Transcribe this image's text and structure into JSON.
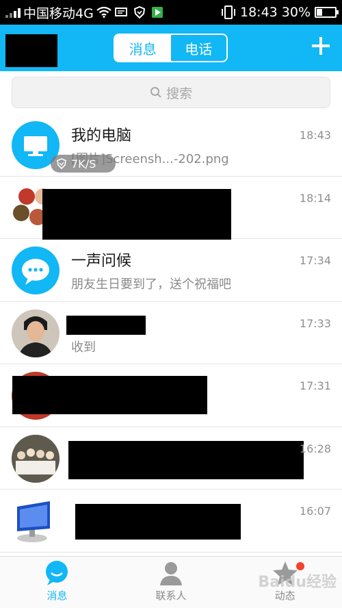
{
  "status_bar": {
    "carrier": "中国移动4G",
    "time": "18:43",
    "battery": "30%",
    "battery_level": 0.3,
    "icons": [
      "signal-icon",
      "wifi-icon",
      "sim-icon",
      "shield-icon",
      "play-store-icon",
      "phone-vibrate-icon",
      "battery-icon"
    ]
  },
  "header": {
    "tabs": [
      {
        "label": "消息",
        "active": true
      },
      {
        "label": "电话",
        "active": false
      }
    ],
    "add_icon": "plus-icon",
    "accent": "#12b7f5"
  },
  "search": {
    "placeholder": "搜索",
    "icon": "search-icon"
  },
  "conversations": [
    {
      "name": "我的电脑",
      "message": "[图片]Screensh...-202.png",
      "time": "18:43",
      "badge": "7K/S",
      "avatar": "computer-icon"
    },
    {
      "name": "",
      "message": "",
      "time": "18:14",
      "avatar": "group-avatar"
    },
    {
      "name": "一声问候",
      "message": "朋友生日要到了，送个祝福吧",
      "time": "17:34",
      "avatar": "chat-bubble-icon"
    },
    {
      "name": "",
      "message": "收到",
      "time": "17:33",
      "avatar": "user-photo"
    },
    {
      "name": "",
      "message": "",
      "time": "17:31",
      "avatar": "user-photo"
    },
    {
      "name": "",
      "message": "",
      "time": "16:28",
      "avatar": "group-photo"
    },
    {
      "name": "",
      "message": "",
      "time": "16:07",
      "avatar": "monitor-photo"
    }
  ],
  "tab_bar": [
    {
      "label": "消息",
      "icon": "chat-icon",
      "active": true
    },
    {
      "label": "联系人",
      "icon": "contact-icon",
      "active": false
    },
    {
      "label": "动态",
      "icon": "star-icon",
      "active": false,
      "has_dot": true
    }
  ],
  "watermark": "Baidu经验"
}
